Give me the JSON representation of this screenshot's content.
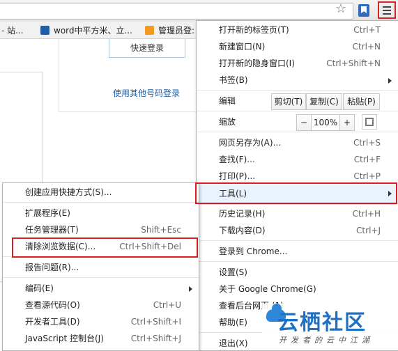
{
  "bookmarks": [
    {
      "label": "- 站...",
      "color": "#ffffff"
    },
    {
      "label": "word中平方米、立...",
      "color": "#1d5fa8"
    },
    {
      "label": "管理员登:",
      "color": "#f29b1e"
    }
  ],
  "page": {
    "quick_login": "快速登录",
    "other_login": "使用其他号码登录"
  },
  "main_menu": {
    "new_tab": {
      "label": "打开新的标签页(T)",
      "shortcut": "Ctrl+T"
    },
    "new_window": {
      "label": "新建窗口(N)",
      "shortcut": "Ctrl+N"
    },
    "incognito": {
      "label": "打开新的隐身窗口(I)",
      "shortcut": "Ctrl+Shift+N"
    },
    "bookmarks": {
      "label": "书签(B)"
    },
    "edit": {
      "label": "编辑",
      "cut": "剪切(T)",
      "copy": "复制(C)",
      "paste": "粘贴(P)"
    },
    "zoom": {
      "label": "缩放",
      "minus": "−",
      "value": "100%",
      "plus": "+"
    },
    "save_page": {
      "label": "网页另存为(A)...",
      "shortcut": "Ctrl+S"
    },
    "find": {
      "label": "查找(F)...",
      "shortcut": "Ctrl+F"
    },
    "print": {
      "label": "打印(P)...",
      "shortcut": "Ctrl+P"
    },
    "tools": {
      "label": "工具(L)"
    },
    "history": {
      "label": "历史记录(H)",
      "shortcut": "Ctrl+H"
    },
    "downloads": {
      "label": "下载内容(D)",
      "shortcut": "Ctrl+J"
    },
    "signin": {
      "label": "登录到 Chrome..."
    },
    "settings": {
      "label": "设置(S)"
    },
    "about": {
      "label": "关于 Google Chrome(G)"
    },
    "background": {
      "label": "查看后台网页 (1)"
    },
    "help": {
      "label": "帮助(E)"
    },
    "exit": {
      "label": "退出(X)"
    }
  },
  "tools_menu": {
    "shortcuts": {
      "label": "创建应用快捷方式(S)..."
    },
    "extensions": {
      "label": "扩展程序(E)"
    },
    "task_manager": {
      "label": "任务管理器(T)",
      "shortcut": "Shift+Esc"
    },
    "clear_data": {
      "label": "清除浏览数据(C)...",
      "shortcut": "Ctrl+Shift+Del"
    },
    "report": {
      "label": "报告问题(R)..."
    },
    "encoding": {
      "label": "编码(E)"
    },
    "view_source": {
      "label": "查看源代码(O)",
      "shortcut": "Ctrl+U"
    },
    "devtools": {
      "label": "开发者工具(D)",
      "shortcut": "Ctrl+Shift+I"
    },
    "js_console": {
      "label": "JavaScript 控制台(J)",
      "shortcut": "Ctrl+Shift+J"
    }
  },
  "watermark": {
    "title": "云栖社区",
    "subtitle": "开发者的云中江湖"
  },
  "colors": {
    "highlight_box": "#d71f1f",
    "link": "#1f5fa8"
  }
}
